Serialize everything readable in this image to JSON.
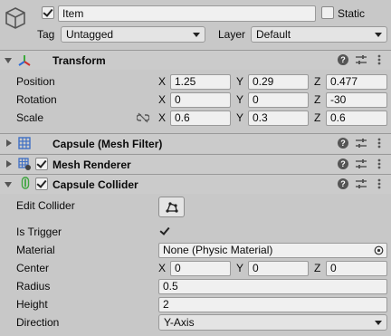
{
  "object": {
    "name": "Item",
    "active": true,
    "static_label": "Static",
    "static": false,
    "tag_label": "Tag",
    "tag_value": "Untagged",
    "layer_label": "Layer",
    "layer_value": "Default",
    "icon": "cube-icon"
  },
  "transform": {
    "title": "Transform",
    "icon": "transform-axes-icon",
    "rows": [
      {
        "label": "Position",
        "x": "1.25",
        "y": "0.29",
        "z": "0.477"
      },
      {
        "label": "Rotation",
        "x": "0",
        "y": "0",
        "z": "-30"
      },
      {
        "label": "Scale",
        "x": "0.6",
        "y": "0.3",
        "z": "0.6"
      }
    ],
    "axes": {
      "x": "X",
      "y": "Y",
      "z": "Z"
    },
    "scale_link_icon": "link-broken-icon"
  },
  "mesh_filter": {
    "title": "Capsule (Mesh Filter)",
    "icon": "grid-mesh-icon"
  },
  "mesh_renderer": {
    "title": "Mesh Renderer",
    "icon": "mesh-renderer-icon",
    "enabled": true
  },
  "capsule_collider": {
    "title": "Capsule Collider",
    "icon": "capsule-collider-icon",
    "enabled": true,
    "edit_collider_label": "Edit Collider",
    "edit_collider_icon": "edit-shape-icon",
    "is_trigger_label": "Is Trigger",
    "is_trigger": true,
    "material_label": "Material",
    "material_value": "None (Physic Material)",
    "center_label": "Center",
    "center": {
      "x": "0",
      "y": "0",
      "z": "0"
    },
    "radius_label": "Radius",
    "radius": "0.5",
    "height_label": "Height",
    "height": "2",
    "direction_label": "Direction",
    "direction": "Y-Axis"
  },
  "header_icons": {
    "help": "?",
    "help_icon": "help-icon",
    "presets_icon": "presets-icon",
    "menu_icon": "kebab-menu-icon"
  },
  "colors": {
    "background": "#c8c8c8",
    "field": "#f0f0f0",
    "accent_x": "#d0312d",
    "accent_y": "#3ba93b",
    "accent_z": "#2b6bd6",
    "collider_green": "#3da53d",
    "mesh_blue": "#3f6fc4"
  }
}
